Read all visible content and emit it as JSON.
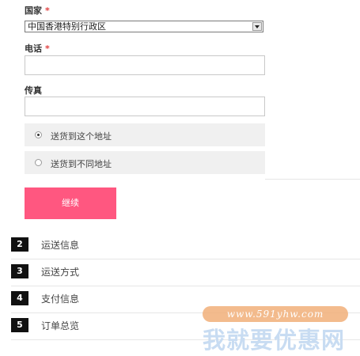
{
  "form": {
    "country_label": "国家",
    "required_mark": "*",
    "country_value": "中国香港特别行政区",
    "phone_label": "电话",
    "fax_label": "传真",
    "ship_same_label": "送货到这个地址",
    "ship_diff_label": "送货到不同地址",
    "continue_label": "继续"
  },
  "steps": [
    {
      "num": "2",
      "label": "运送信息"
    },
    {
      "num": "3",
      "label": "运送方式"
    },
    {
      "num": "4",
      "label": "支付信息"
    },
    {
      "num": "5",
      "label": "订单总览"
    }
  ],
  "watermark": {
    "url": "www.591yhw.com",
    "text": "我就要优惠网"
  }
}
